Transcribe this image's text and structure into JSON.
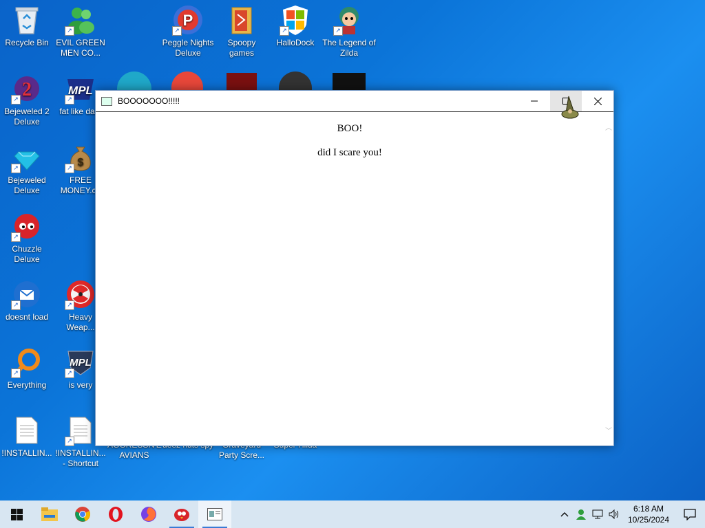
{
  "desktop": {
    "icons": [
      {
        "label": "Recycle Bin"
      },
      {
        "label": "EVIL GREEN MEN CO..."
      },
      {
        "label": "Peggle Nights Deluxe"
      },
      {
        "label": "Spoopy games"
      },
      {
        "label": "HalloDock"
      },
      {
        "label": "The Legend of Zilda"
      },
      {
        "label": "Bejeweled 2 Deluxe"
      },
      {
        "label": "fat like dark"
      },
      {
        "label": "Bejeweled Deluxe"
      },
      {
        "label": "FREE MONEY.co"
      },
      {
        "label": "Chuzzle Deluxe"
      },
      {
        "label": "doesnt load"
      },
      {
        "label": "Heavy Weap..."
      },
      {
        "label": "Everything"
      },
      {
        "label": "is very"
      },
      {
        "label": "!INSTALLIN..."
      },
      {
        "label": "!INSTALLIN... - Shortcut"
      },
      {
        "label": "AGGRESSIVE AVIANS"
      },
      {
        "label": "deez nuts spy"
      },
      {
        "label": "Graveyard Party Scre..."
      },
      {
        "label": "Super Hilda"
      }
    ]
  },
  "window": {
    "title": "BOOOOOOO!!!!!",
    "heading": "BOO!",
    "body": "did I scare you!"
  },
  "taskbar": {
    "pinned": [
      "start-icon",
      "file-explorer-icon",
      "chrome-icon",
      "opera-icon",
      "firefox-icon",
      "angry-bird-icon",
      "window-app-icon"
    ],
    "time": "6:18 AM",
    "date": "10/25/2024"
  },
  "colors": {
    "desktop": "#0b74d8",
    "taskbar": "#d8e6f2",
    "accent": "#3a7bd5"
  }
}
